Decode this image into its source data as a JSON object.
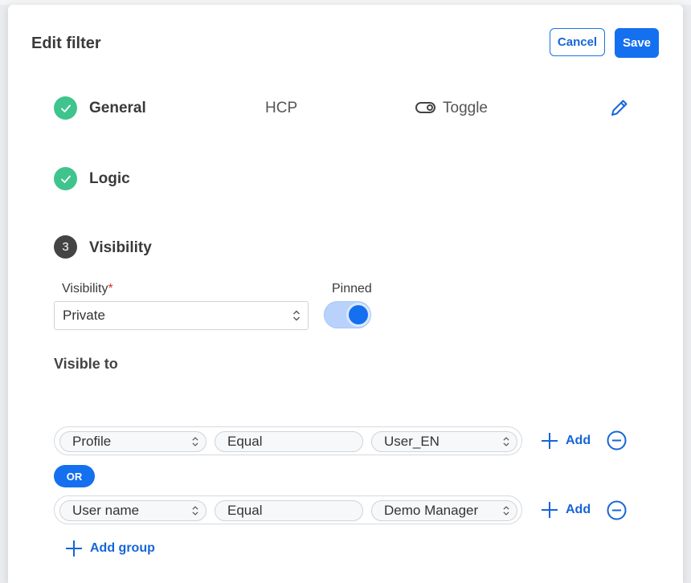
{
  "modal": {
    "title": "Edit filter",
    "cancel_label": "Cancel",
    "save_label": "Save"
  },
  "steps": {
    "general": {
      "label": "General",
      "type_value": "HCP",
      "display_value": "Toggle",
      "status": "complete",
      "icon": "check-icon",
      "edit_icon": "pencil-icon"
    },
    "logic": {
      "label": "Logic",
      "status": "complete",
      "icon": "check-icon"
    },
    "visibility": {
      "number": "3",
      "label": "Visibility",
      "status": "active"
    }
  },
  "visibility_form": {
    "visibility_label": "Visibility",
    "required_mark": "*",
    "visibility_value": "Private",
    "pinned_label": "Pinned",
    "pinned_on": true,
    "visible_to_label": "Visible to"
  },
  "rules": [
    {
      "field": "Profile",
      "operator": "Equal",
      "value": "User_EN"
    },
    {
      "field": "User name",
      "operator": "Equal",
      "value": "Demo Manager"
    }
  ],
  "connector_label": "OR",
  "add_label": "Add",
  "add_group_label": "Add group",
  "colors": {
    "primary": "#1570ef",
    "success": "#3fc48e",
    "step_active": "#444444",
    "switch_track": "#b8d2fb"
  }
}
